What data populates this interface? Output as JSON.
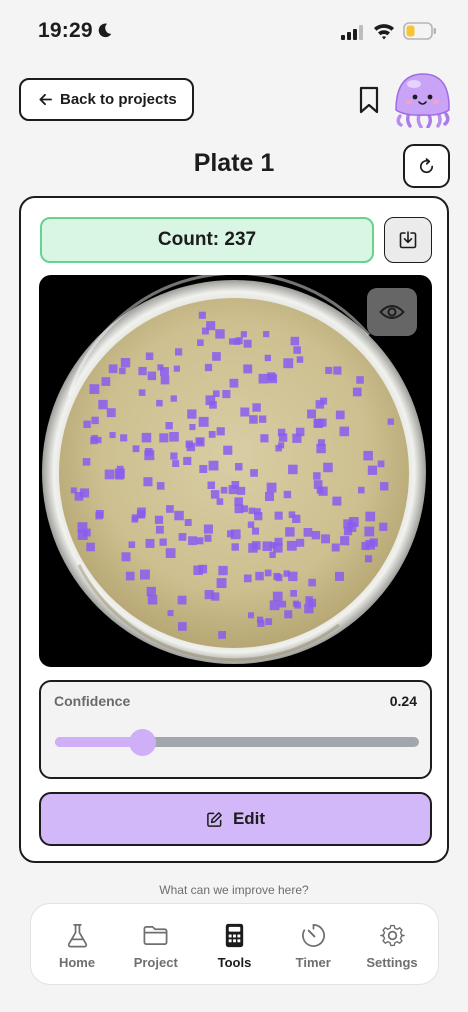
{
  "status_bar": {
    "time": "19:29",
    "icons": [
      "moon-icon",
      "signal-icon",
      "wifi-icon",
      "battery-low-icon"
    ],
    "battery_color": "#f6c533"
  },
  "header": {
    "back_label": "Back to projects",
    "back_icon": "arrow-left-icon",
    "bookmark_icon": "bookmark-icon",
    "avatar": "jellyfish-mascot"
  },
  "page": {
    "title": "Plate 1",
    "refresh_icon": "refresh-icon"
  },
  "count": {
    "text": "Count: 237",
    "value": 237,
    "bg_color": "#d9f5e4",
    "border_color": "#64d48f",
    "download_icon": "download-icon"
  },
  "plate": {
    "visibility_icon": "eye-icon",
    "marker_color": "#8a5cf0",
    "agar_color": "#cfc195"
  },
  "confidence": {
    "label": "Confidence",
    "value_text": "0.24",
    "value": 0.24,
    "accent": "#cfb0f7"
  },
  "edit": {
    "label": "Edit",
    "icon": "edit-icon",
    "bg_color": "#d2b8f9"
  },
  "feedback": {
    "text": "What can we improve here?"
  },
  "tabs": [
    {
      "label": "Home",
      "icon": "flask-icon",
      "active": false
    },
    {
      "label": "Project",
      "icon": "folder-icon",
      "active": false
    },
    {
      "label": "Tools",
      "icon": "calculator-icon",
      "active": true
    },
    {
      "label": "Timer",
      "icon": "timer-icon",
      "active": false
    },
    {
      "label": "Settings",
      "icon": "gear-icon",
      "active": false
    }
  ]
}
